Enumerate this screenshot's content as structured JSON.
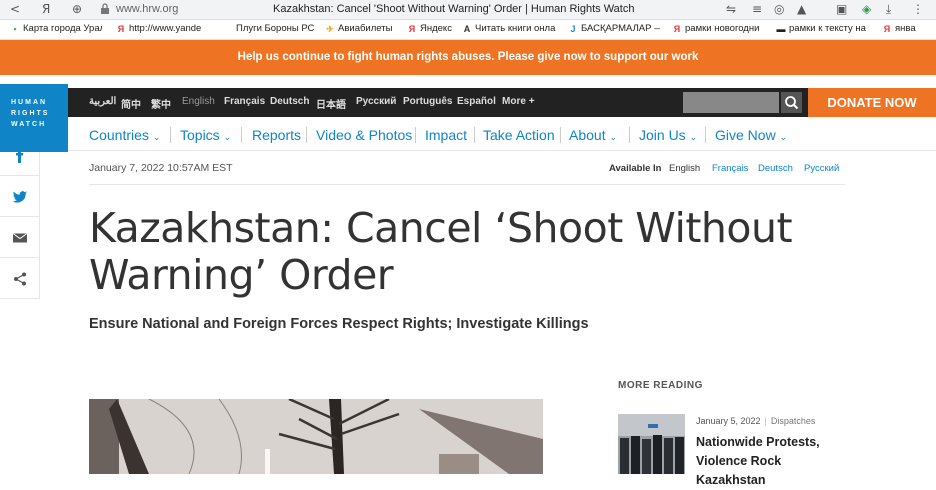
{
  "browser": {
    "url": "www.hrw.org",
    "title": "Kazakhstan: Cancel 'Shoot Without Warning' Order | Human Rights Watch",
    "bookmarks": [
      {
        "label": "Карта города Урал",
        "icon": "map-icon",
        "color": "#4caf50"
      },
      {
        "label": "http://www.yande",
        "icon": "yandex-icon",
        "color": "#e53935"
      },
      {
        "label": "Плуги Бороны РС",
        "icon": "",
        "color": ""
      },
      {
        "label": "Авиабилеты",
        "icon": "plane-icon",
        "color": "#f5a623"
      },
      {
        "label": "Яндекс",
        "icon": "yandex-icon",
        "color": "#e53935"
      },
      {
        "label": "Читать книги онла",
        "icon": "book-icon",
        "color": "#333"
      },
      {
        "label": "БАСҚАРМАЛАР —",
        "icon": "j-icon",
        "color": "#1e88e5"
      },
      {
        "label": "рамки новогодни",
        "icon": "yandex-icon",
        "color": "#e53935"
      },
      {
        "label": "рамки к тексту на",
        "icon": "folder-icon",
        "color": "#222"
      },
      {
        "label": "янва",
        "icon": "yandex-icon",
        "color": "#e53935"
      }
    ]
  },
  "banner": {
    "text": "Help us continue to fight human rights abuses. Please give now to support our work"
  },
  "logo": {
    "line1": "HUMAN",
    "line2": "RIGHTS",
    "line3": "WATCH"
  },
  "languages": [
    "العربية",
    "简中",
    "繁中",
    "English",
    "Français",
    "Deutsch",
    "日本語",
    "Русский",
    "Português",
    "Español",
    "More"
  ],
  "donate_button": "DONATE NOW",
  "nav": [
    "Countries",
    "Topics",
    "Reports",
    "Video & Photos",
    "Impact",
    "Take Action",
    "About",
    "Join Us",
    "Give Now"
  ],
  "article": {
    "date": "January 7, 2022 10:57AM EST",
    "available_label": "Available In",
    "available": [
      "English",
      "Français",
      "Deutsch",
      "Русский"
    ],
    "title_line1": "Kazakhstan: Cancel ‘Shoot Without",
    "title_line2": "Warning’ Order",
    "subtitle": "Ensure National and Foreign Forces Respect Rights; Investigate Killings"
  },
  "more_reading": {
    "label": "MORE READING",
    "items": [
      {
        "date": "January 5, 2022",
        "type": "Dispatches",
        "title": "Nationwide Protests, Violence Rock Kazakhstan"
      }
    ]
  },
  "colors": {
    "accent": "#0f84c7",
    "orange": "#ee7323",
    "dark": "#222222"
  }
}
